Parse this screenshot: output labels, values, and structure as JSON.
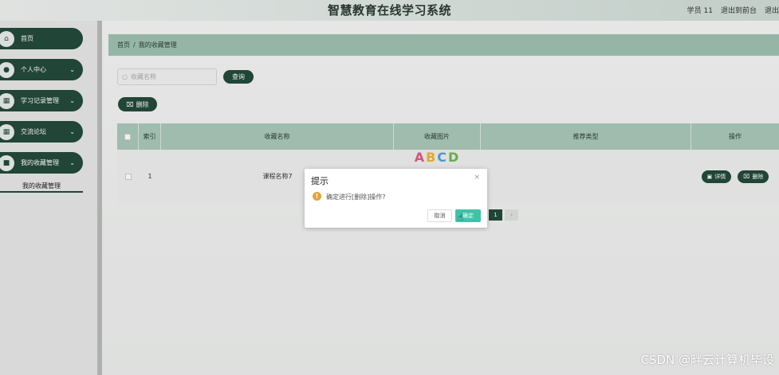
{
  "header": {
    "title": "智慧教育在线学习系统",
    "user": "学员 11",
    "back_to_front": "退出到前台",
    "logout": "退出"
  },
  "sidebar": {
    "items": [
      {
        "label": "首页",
        "icon": "home-icon",
        "has_arrow": false
      },
      {
        "label": "个人中心",
        "icon": "user-icon",
        "has_arrow": true
      },
      {
        "label": "学习记录管理",
        "icon": "grid-icon",
        "has_arrow": true
      },
      {
        "label": "交流论坛",
        "icon": "grid-icon",
        "has_arrow": true
      },
      {
        "label": "我的收藏管理",
        "icon": "lock-icon",
        "has_arrow": true
      }
    ],
    "sub_item": "我的收藏管理"
  },
  "breadcrumb": {
    "home": "首页",
    "sep": "/",
    "current": "我的收藏管理"
  },
  "search": {
    "placeholder": "收藏名称",
    "button": "查询"
  },
  "delete_button": "删除",
  "table": {
    "headers": [
      "索引",
      "收藏名称",
      "收藏图片",
      "推荐类型",
      "操作"
    ],
    "rows": [
      {
        "index": "1",
        "name": "课程名称7",
        "image_text": "ABCD",
        "type": "",
        "detail": "详情",
        "delete": "删除"
      }
    ]
  },
  "pager": {
    "current": "1"
  },
  "dialog": {
    "title": "提示",
    "close": "×",
    "message": "确定进行[删除]操作?",
    "cancel": "取消",
    "ok": "确定"
  },
  "watermark": "CSDN @畔云计算机毕设",
  "colors": {
    "primary": "#244a3b",
    "header_row": "#a9c8b9",
    "ok_button": "#3fc3a7",
    "warning": "#e6a23c"
  }
}
